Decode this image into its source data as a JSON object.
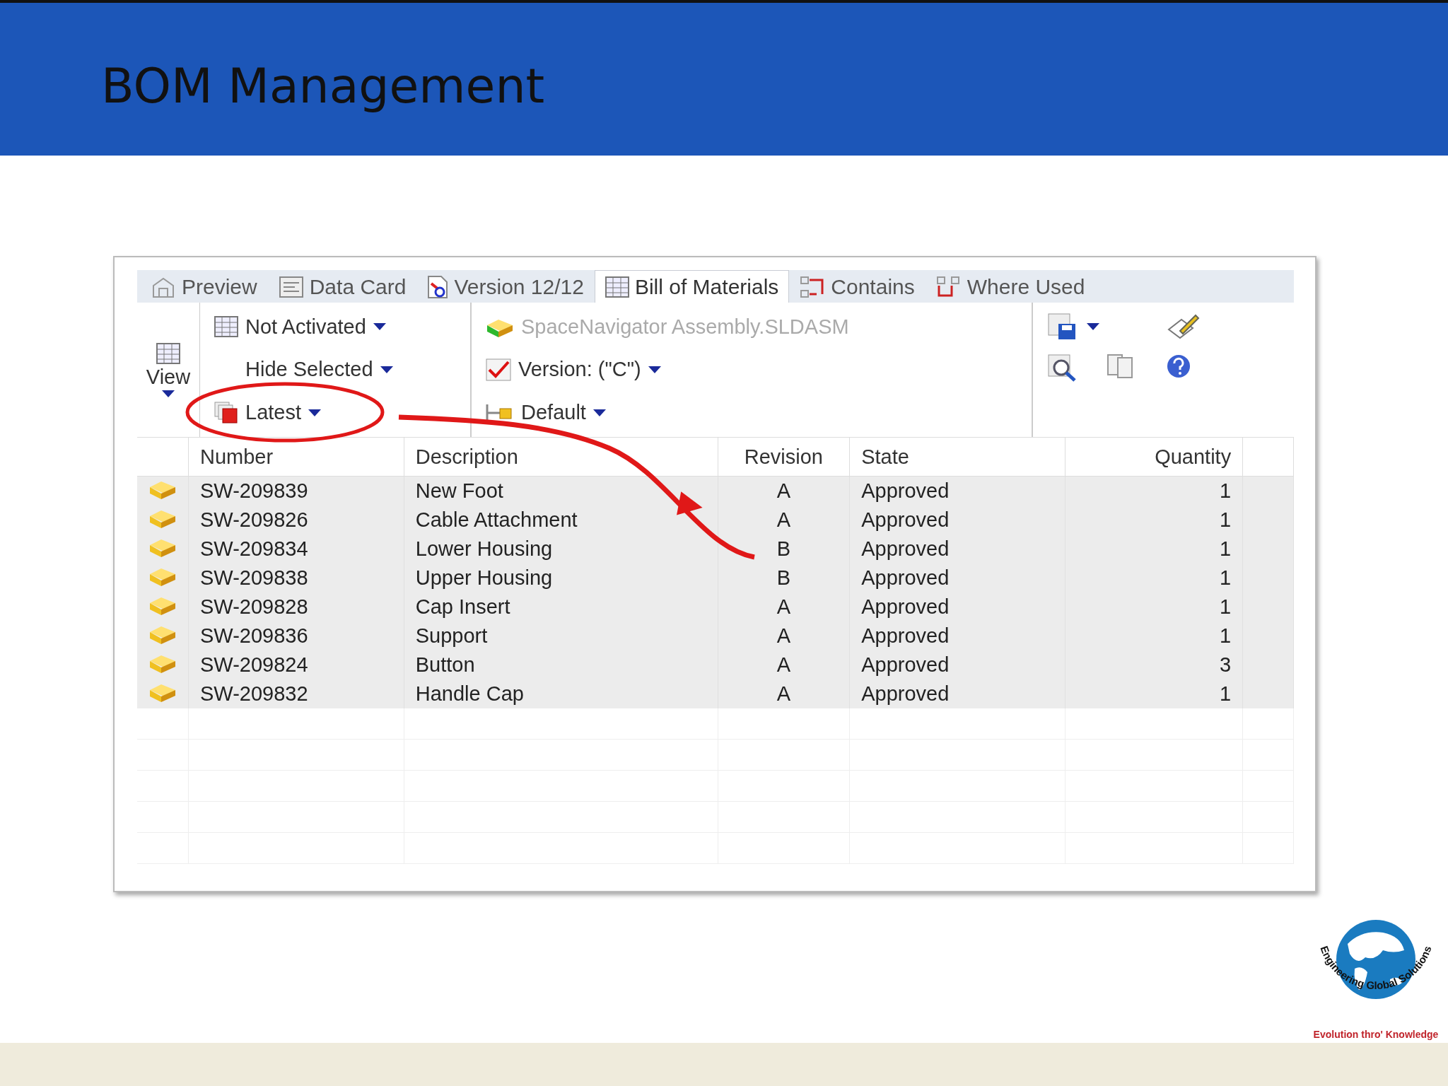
{
  "slide": {
    "title": "BOM Management"
  },
  "window": {
    "tabs": [
      {
        "label": "Preview",
        "selected": false
      },
      {
        "label": "Data Card",
        "selected": false
      },
      {
        "label": "Version 12/12",
        "selected": false
      },
      {
        "label": "Bill of Materials",
        "selected": true
      },
      {
        "label": "Contains",
        "selected": false
      },
      {
        "label": "Where Used",
        "selected": false
      }
    ],
    "toolbar": {
      "view_label": "View",
      "filters": [
        "Not Activated",
        "Hide Selected",
        "Latest"
      ],
      "assembly": "SpaceNavigator Assembly.SLDASM",
      "version": "Version:  (\"C\")",
      "configuration": "Default"
    },
    "table": {
      "columns": [
        "Number",
        "Description",
        "Revision",
        "State",
        "Quantity"
      ],
      "rows": [
        [
          "SW-209839",
          "New Foot",
          "A",
          "Approved",
          "1"
        ],
        [
          "SW-209826",
          "Cable Attachment",
          "A",
          "Approved",
          "1"
        ],
        [
          "SW-209834",
          "Lower Housing",
          "B",
          "Approved",
          "1"
        ],
        [
          "SW-209838",
          "Upper Housing",
          "B",
          "Approved",
          "1"
        ],
        [
          "SW-209828",
          "Cap Insert",
          "A",
          "Approved",
          "1"
        ],
        [
          "SW-209836",
          "Support",
          "A",
          "Approved",
          "1"
        ],
        [
          "SW-209824",
          "Button",
          "A",
          "Approved",
          "3"
        ],
        [
          "SW-209832",
          "Handle Cap",
          "A",
          "Approved",
          "1"
        ]
      ]
    }
  },
  "logo": {
    "ring_text": "Engineering Global Solutions",
    "tagline": "Evolution thro' Knowledge"
  }
}
